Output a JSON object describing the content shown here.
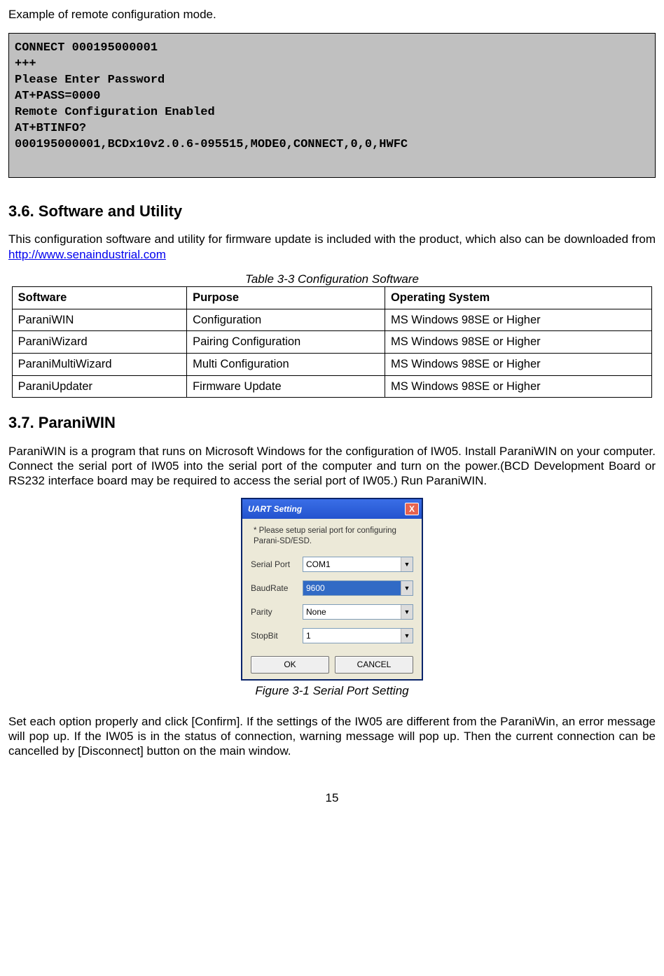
{
  "intro": "Example of remote configuration mode.",
  "terminal": "CONNECT 000195000001\n+++\nPlease Enter Password\nAT+PASS=0000\nRemote Configuration Enabled\nAT+BTINFO?\n000195000001,BCDx10v2.0.6-095515,MODE0,CONNECT,0,0,HWFC",
  "section36": {
    "heading": "3.6. Software and Utility",
    "para1a": "This configuration software and utility for firmware update is included with the product, which also can be downloaded from ",
    "link": "http://www.senaindustrial.com",
    "tableCaption": "Table 3-3 Configuration Software",
    "headers": {
      "c1": "Software",
      "c2": "Purpose",
      "c3": "Operating System"
    },
    "rows": [
      {
        "c1": "ParaniWIN",
        "c2": "Configuration",
        "c3": "MS Windows 98SE or Higher"
      },
      {
        "c1": "ParaniWizard",
        "c2": "Pairing Configuration",
        "c3": "MS Windows 98SE or Higher"
      },
      {
        "c1": "ParaniMultiWizard",
        "c2": "Multi Configuration",
        "c3": "MS Windows 98SE or Higher"
      },
      {
        "c1": "ParaniUpdater",
        "c2": "Firmware Update",
        "c3": "MS Windows 98SE or Higher"
      }
    ]
  },
  "section37": {
    "heading": "3.7. ParaniWIN",
    "para": "ParaniWIN is a program that runs on Microsoft Windows for the configuration of IW05. Install ParaniWIN on your computer. Connect the serial port of IW05 into the serial port of the computer and turn on the power.(BCD Development Board or RS232 interface board may be required to access the serial port of IW05.) Run ParaniWIN.",
    "figCaption": "Figure 3-1 Serial Port Setting",
    "para2": "Set each option properly and click [Confirm]. If the settings of the IW05 are different from the ParaniWin, an error message will pop up. If the IW05 is in the status of connection, warning message will pop up. Then the current connection can be cancelled by [Disconnect] button on the main window."
  },
  "dialog": {
    "title": "UART Setting",
    "hint": "* Please setup serial port for configuring Parani-SD/ESD.",
    "labels": {
      "port": "Serial Port",
      "baud": "BaudRate",
      "parity": "Parity",
      "stop": "StopBit"
    },
    "values": {
      "port": "COM1",
      "baud": "9600",
      "parity": "None",
      "stop": "1"
    },
    "ok": "OK",
    "cancel": "CANCEL",
    "close": "X"
  },
  "pageNumber": "15"
}
